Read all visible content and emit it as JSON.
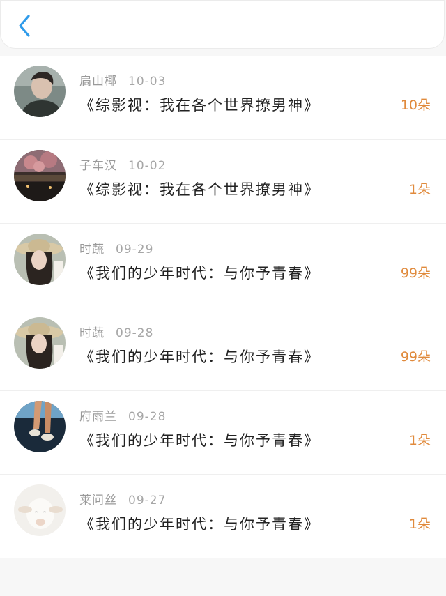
{
  "header": {
    "back_icon": "chevron-left-icon",
    "accent": "#2f9bea"
  },
  "colors": {
    "count": "#e08a3c",
    "meta": "#9a9a9a",
    "title": "#222222"
  },
  "list": [
    {
      "name": "扃山椰",
      "date": "10-03",
      "title": "《综影视：我在各个世界撩男神》",
      "count": "10朵",
      "avatar": "avatar-man"
    },
    {
      "name": "子车汉",
      "date": "10-02",
      "title": "《综影视：我在各个世界撩男神》",
      "count": "1朵",
      "avatar": "avatar-scenery"
    },
    {
      "name": "时蔬",
      "date": "09-29",
      "title": "《我们的少年时代：与你予青春》",
      "count": "99朵",
      "avatar": "avatar-girl-hat"
    },
    {
      "name": "时蔬",
      "date": "09-28",
      "title": "《我们的少年时代：与你予青春》",
      "count": "99朵",
      "avatar": "avatar-girl-hat"
    },
    {
      "name": "府雨兰",
      "date": "09-28",
      "title": "《我们的少年时代：与你予青春》",
      "count": "1朵",
      "avatar": "avatar-legs"
    },
    {
      "name": "莱问丝",
      "date": "09-27",
      "title": "《我们的少年时代：与你予青春》",
      "count": "1朵",
      "avatar": "avatar-lamb"
    }
  ]
}
